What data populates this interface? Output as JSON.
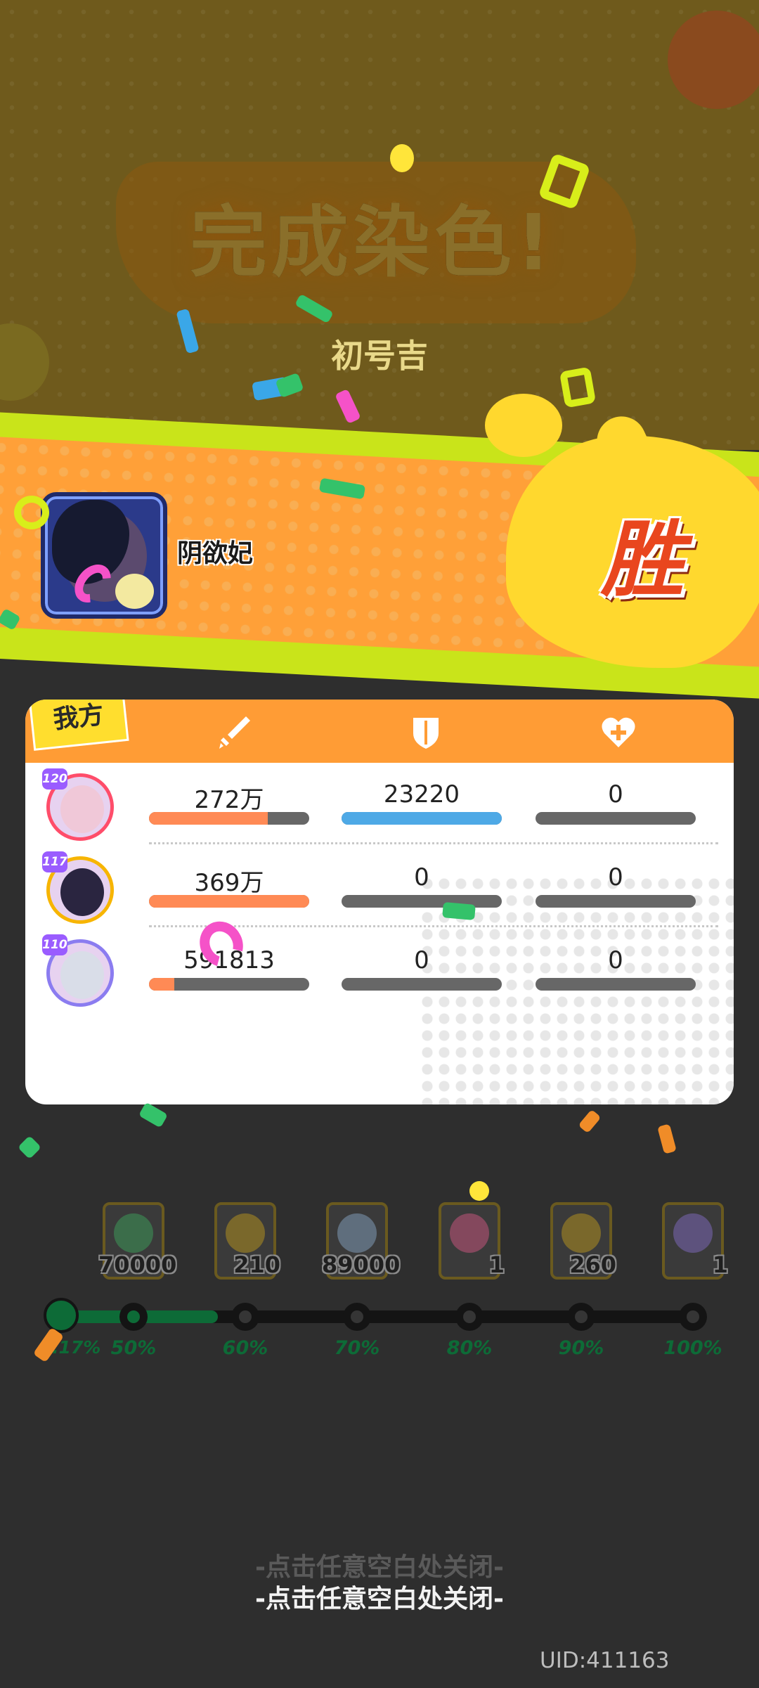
{
  "result": {
    "headline": "完成染色!",
    "enemy_name": "初号吉",
    "victory_label": "胜"
  },
  "player": {
    "name": "阴欲妃"
  },
  "stats_panel": {
    "team_label": "我方",
    "columns": [
      "sword-icon",
      "shield-icon",
      "heart-icon"
    ],
    "rows": [
      {
        "level": "120",
        "damage": "272万",
        "damage_fill": 0.74,
        "taken": "23220",
        "taken_fill": 1.0,
        "heal": "0",
        "heal_fill": 0,
        "border": "#ff4d6a",
        "face": "#f0c8d8"
      },
      {
        "level": "117",
        "damage": "369万",
        "damage_fill": 1.0,
        "taken": "0",
        "taken_fill": 0,
        "heal": "0",
        "heal_fill": 0,
        "border": "#f7b500",
        "face": "#2a2540"
      },
      {
        "level": "110",
        "damage": "591813",
        "damage_fill": 0.16,
        "taken": "0",
        "taken_fill": 0,
        "heal": "0",
        "heal_fill": 0,
        "border": "#8b7cf0",
        "face": "#d9dde8"
      }
    ],
    "colors": {
      "damage": "#ff8a55",
      "taken": "#4ea9e6",
      "empty": "#676767"
    }
  },
  "rewards": [
    {
      "qty": "70000",
      "icon": "checked-chest-icon",
      "color": "#3fae60"
    },
    {
      "qty": "210",
      "icon": "coin-icon",
      "color": "#c9a21a"
    },
    {
      "qty": "89000",
      "icon": "paint-tube-icon",
      "color": "#8fb0d0"
    },
    {
      "qty": "1",
      "icon": "gift-box-icon",
      "color": "#e05a8a"
    },
    {
      "qty": "260",
      "icon": "coin-icon",
      "color": "#c9a21a"
    },
    {
      "qty": "1",
      "icon": "ticket-icon",
      "color": "#8a70d0"
    }
  ],
  "progress": {
    "current_label": "4.17%",
    "milestones": [
      "50%",
      "60%",
      "70%",
      "80%",
      "90%",
      "100%"
    ]
  },
  "close_prompt": "-点击任意空白处关闭-",
  "uid": "UID:411163"
}
